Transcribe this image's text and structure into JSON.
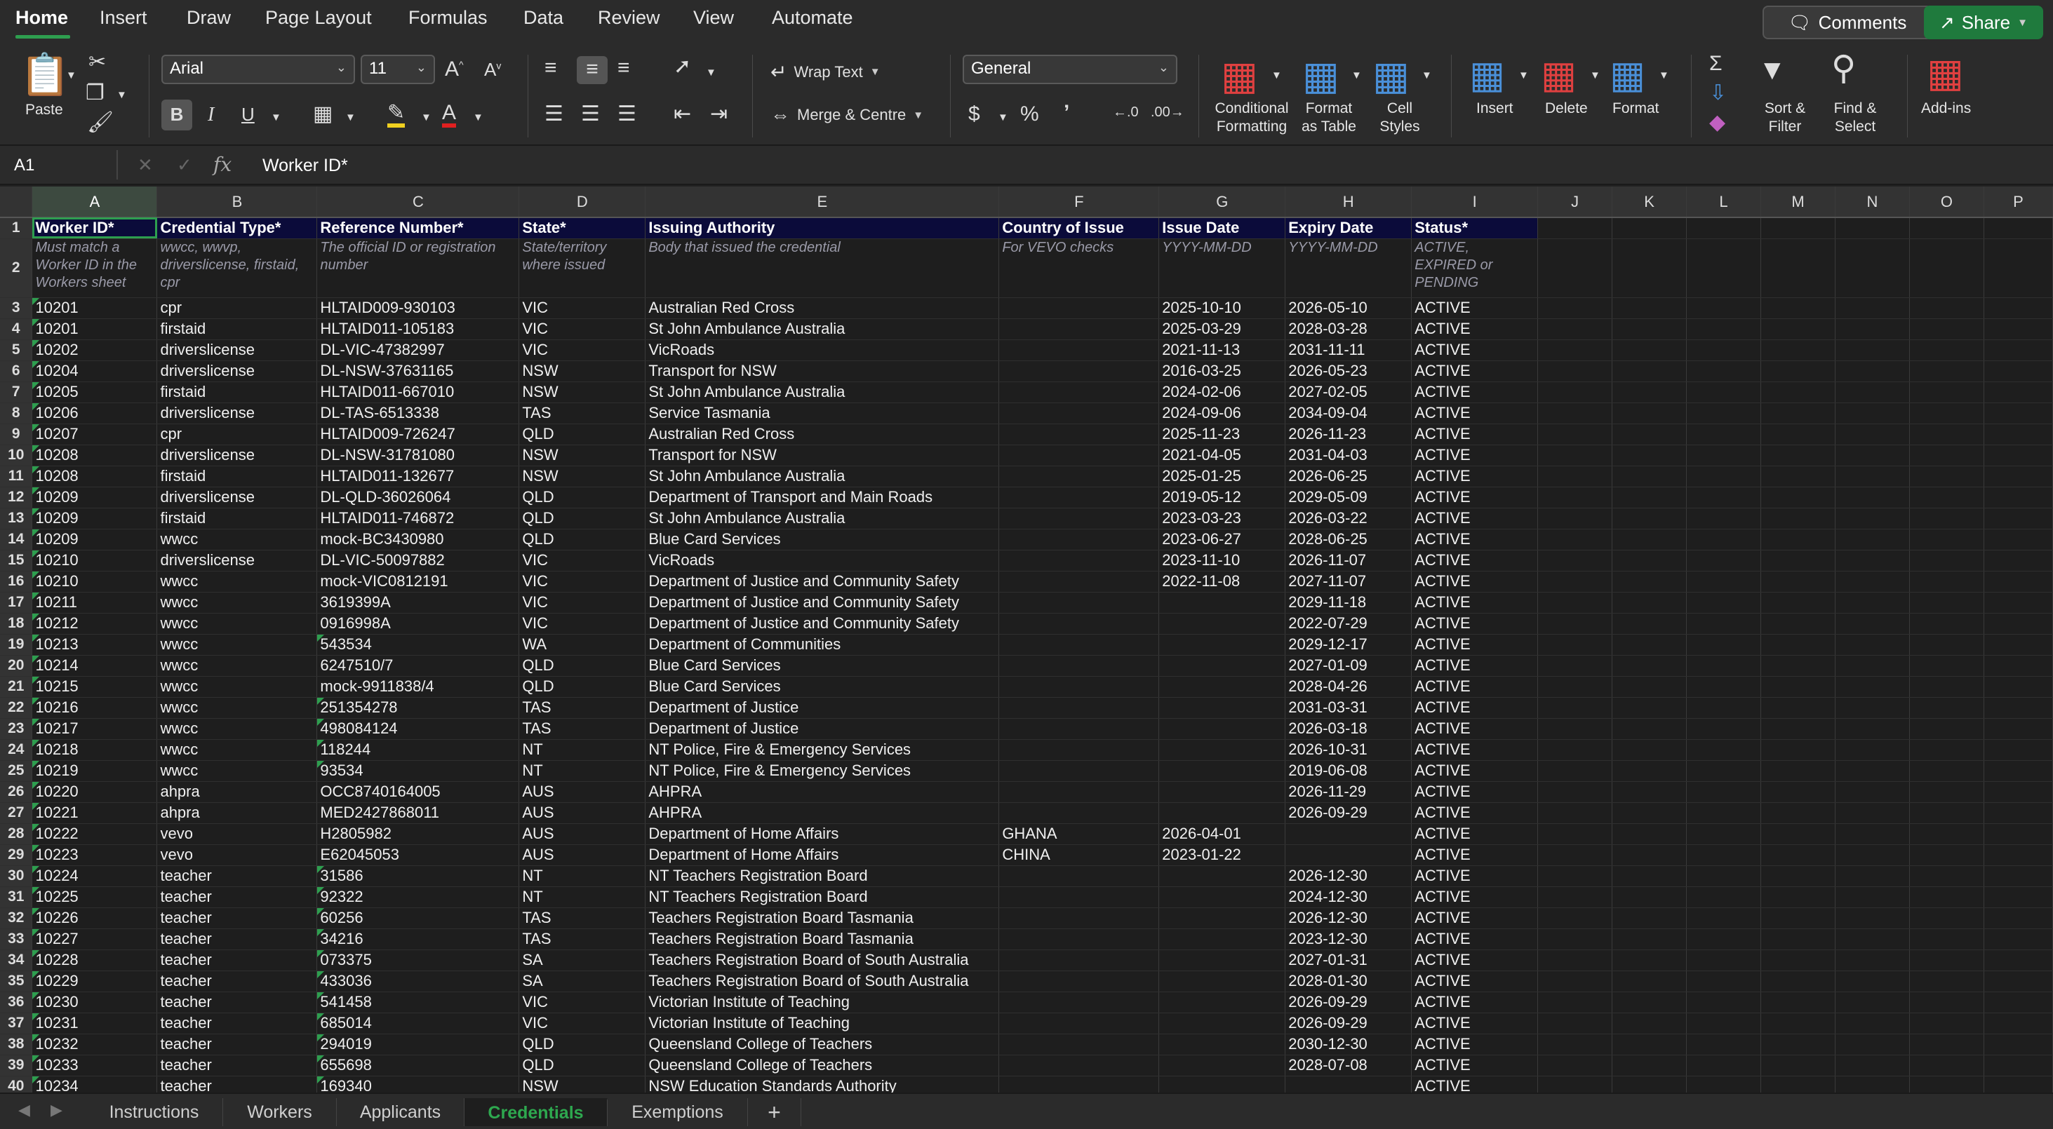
{
  "menu": {
    "tabs": [
      "Home",
      "Insert",
      "Draw",
      "Page Layout",
      "Formulas",
      "Data",
      "Review",
      "View",
      "Automate"
    ],
    "comments": "Comments",
    "share": "Share"
  },
  "ribbon": {
    "paste": "Paste",
    "font_name": "Arial",
    "font_size": "11",
    "wrap_text": "Wrap Text",
    "merge": "Merge & Centre",
    "number_format": "General",
    "conditional_formatting": "Conditional\nFormatting",
    "format_as_table": "Format\nas Table",
    "cell_styles": "Cell\nStyles",
    "insert": "Insert",
    "delete": "Delete",
    "format": "Format",
    "sort_filter": "Sort &\nFilter",
    "find_select": "Find &\nSelect",
    "add_ins": "Add-ins",
    "accent_green": "#2e9e4f"
  },
  "formula_bar": {
    "name_box": "A1",
    "fx": "fx",
    "content": "Worker ID*"
  },
  "columns": [
    "A",
    "B",
    "C",
    "D",
    "E",
    "F",
    "G",
    "H",
    "I",
    "J",
    "K",
    "L",
    "M",
    "N",
    "O",
    "P"
  ],
  "header_row": [
    "Worker ID*",
    "Credential Type*",
    "Reference Number*",
    "State*",
    "Issuing Authority",
    "Country of Issue",
    "Issue Date",
    "Expiry Date",
    "Status*"
  ],
  "hint_row": [
    "Must match a Worker ID in the Workers sheet",
    "wwcc, wwvp, driverslicense, firstaid, cpr",
    "The official ID or registration number",
    "State/territory where issued",
    "Body that issued the credential",
    "For VEVO checks",
    "YYYY-MM-DD",
    "YYYY-MM-DD",
    "ACTIVE, EXPIRED or PENDING"
  ],
  "rows": [
    [
      "10201",
      "cpr",
      "HLTAID009-930103",
      "VIC",
      "Australian Red Cross",
      "",
      "2025-10-10",
      "2026-05-10",
      "ACTIVE"
    ],
    [
      "10201",
      "firstaid",
      "HLTAID011-105183",
      "VIC",
      "St John Ambulance Australia",
      "",
      "2025-03-29",
      "2028-03-28",
      "ACTIVE"
    ],
    [
      "10202",
      "driverslicense",
      "DL-VIC-47382997",
      "VIC",
      "VicRoads",
      "",
      "2021-11-13",
      "2031-11-11",
      "ACTIVE"
    ],
    [
      "10204",
      "driverslicense",
      "DL-NSW-37631165",
      "NSW",
      "Transport for NSW",
      "",
      "2016-03-25",
      "2026-05-23",
      "ACTIVE"
    ],
    [
      "10205",
      "firstaid",
      "HLTAID011-667010",
      "NSW",
      "St John Ambulance Australia",
      "",
      "2024-02-06",
      "2027-02-05",
      "ACTIVE"
    ],
    [
      "10206",
      "driverslicense",
      "DL-TAS-6513338",
      "TAS",
      "Service Tasmania",
      "",
      "2024-09-06",
      "2034-09-04",
      "ACTIVE"
    ],
    [
      "10207",
      "cpr",
      "HLTAID009-726247",
      "QLD",
      "Australian Red Cross",
      "",
      "2025-11-23",
      "2026-11-23",
      "ACTIVE"
    ],
    [
      "10208",
      "driverslicense",
      "DL-NSW-31781080",
      "NSW",
      "Transport for NSW",
      "",
      "2021-04-05",
      "2031-04-03",
      "ACTIVE"
    ],
    [
      "10208",
      "firstaid",
      "HLTAID011-132677",
      "NSW",
      "St John Ambulance Australia",
      "",
      "2025-01-25",
      "2026-06-25",
      "ACTIVE"
    ],
    [
      "10209",
      "driverslicense",
      "DL-QLD-36026064",
      "QLD",
      "Department of Transport and Main Roads",
      "",
      "2019-05-12",
      "2029-05-09",
      "ACTIVE"
    ],
    [
      "10209",
      "firstaid",
      "HLTAID011-746872",
      "QLD",
      "St John Ambulance Australia",
      "",
      "2023-03-23",
      "2026-03-22",
      "ACTIVE"
    ],
    [
      "10209",
      "wwcc",
      "mock-BC3430980",
      "QLD",
      "Blue Card Services",
      "",
      "2023-06-27",
      "2028-06-25",
      "ACTIVE"
    ],
    [
      "10210",
      "driverslicense",
      "DL-VIC-50097882",
      "VIC",
      "VicRoads",
      "",
      "2023-11-10",
      "2026-11-07",
      "ACTIVE"
    ],
    [
      "10210",
      "wwcc",
      "mock-VIC0812191",
      "VIC",
      "Department of Justice and Community Safety",
      "",
      "2022-11-08",
      "2027-11-07",
      "ACTIVE"
    ],
    [
      "10211",
      "wwcc",
      "3619399A",
      "VIC",
      "Department of Justice and Community Safety",
      "",
      "",
      "2029-11-18",
      "ACTIVE"
    ],
    [
      "10212",
      "wwcc",
      "0916998A",
      "VIC",
      "Department of Justice and Community Safety",
      "",
      "",
      "2022-07-29",
      "ACTIVE"
    ],
    [
      "10213",
      "wwcc",
      "543534",
      "WA",
      "Department of Communities",
      "",
      "",
      "2029-12-17",
      "ACTIVE"
    ],
    [
      "10214",
      "wwcc",
      "6247510/7",
      "QLD",
      "Blue Card Services",
      "",
      "",
      "2027-01-09",
      "ACTIVE"
    ],
    [
      "10215",
      "wwcc",
      "mock-9911838/4",
      "QLD",
      "Blue Card Services",
      "",
      "",
      "2028-04-26",
      "ACTIVE"
    ],
    [
      "10216",
      "wwcc",
      "251354278",
      "TAS",
      "Department of Justice",
      "",
      "",
      "2031-03-31",
      "ACTIVE"
    ],
    [
      "10217",
      "wwcc",
      "498084124",
      "TAS",
      "Department of Justice",
      "",
      "",
      "2026-03-18",
      "ACTIVE"
    ],
    [
      "10218",
      "wwcc",
      "118244",
      "NT",
      "NT Police, Fire & Emergency Services",
      "",
      "",
      "2026-10-31",
      "ACTIVE"
    ],
    [
      "10219",
      "wwcc",
      "93534",
      "NT",
      "NT Police, Fire & Emergency Services",
      "",
      "",
      "2019-06-08",
      "ACTIVE"
    ],
    [
      "10220",
      "ahpra",
      "OCC8740164005",
      "AUS",
      "AHPRA",
      "",
      "",
      "2026-11-29",
      "ACTIVE"
    ],
    [
      "10221",
      "ahpra",
      "MED2427868011",
      "AUS",
      "AHPRA",
      "",
      "",
      "2026-09-29",
      "ACTIVE"
    ],
    [
      "10222",
      "vevo",
      "H2805982",
      "AUS",
      "Department of Home Affairs",
      "GHANA",
      "2026-04-01",
      "",
      "ACTIVE"
    ],
    [
      "10223",
      "vevo",
      "E62045053",
      "AUS",
      "Department of Home Affairs",
      "CHINA",
      "2023-01-22",
      "",
      "ACTIVE"
    ],
    [
      "10224",
      "teacher",
      "31586",
      "NT",
      "NT Teachers Registration Board",
      "",
      "",
      "2026-12-30",
      "ACTIVE"
    ],
    [
      "10225",
      "teacher",
      "92322",
      "NT",
      "NT Teachers Registration Board",
      "",
      "",
      "2024-12-30",
      "ACTIVE"
    ],
    [
      "10226",
      "teacher",
      "60256",
      "TAS",
      "Teachers Registration Board Tasmania",
      "",
      "",
      "2026-12-30",
      "ACTIVE"
    ],
    [
      "10227",
      "teacher",
      "34216",
      "TAS",
      "Teachers Registration Board Tasmania",
      "",
      "",
      "2023-12-30",
      "ACTIVE"
    ],
    [
      "10228",
      "teacher",
      "073375",
      "SA",
      "Teachers Registration Board of South Australia",
      "",
      "",
      "2027-01-31",
      "ACTIVE"
    ],
    [
      "10229",
      "teacher",
      "433036",
      "SA",
      "Teachers Registration Board of South Australia",
      "",
      "",
      "2028-01-30",
      "ACTIVE"
    ],
    [
      "10230",
      "teacher",
      "541458",
      "VIC",
      "Victorian Institute of Teaching",
      "",
      "",
      "2026-09-29",
      "ACTIVE"
    ],
    [
      "10231",
      "teacher",
      "685014",
      "VIC",
      "Victorian Institute of Teaching",
      "",
      "",
      "2026-09-29",
      "ACTIVE"
    ],
    [
      "10232",
      "teacher",
      "294019",
      "QLD",
      "Queensland College of Teachers",
      "",
      "",
      "2030-12-30",
      "ACTIVE"
    ],
    [
      "10233",
      "teacher",
      "655698",
      "QLD",
      "Queensland College of Teachers",
      "",
      "",
      "2028-07-08",
      "ACTIVE"
    ],
    [
      "10234",
      "teacher",
      "169340",
      "NSW",
      "NSW Education Standards Authority",
      "",
      "",
      "",
      "ACTIVE"
    ]
  ],
  "sheets": [
    "Instructions",
    "Workers",
    "Applicants",
    "Credentials",
    "Exemptions"
  ],
  "active_sheet": "Credentials",
  "add_sheet": "+"
}
